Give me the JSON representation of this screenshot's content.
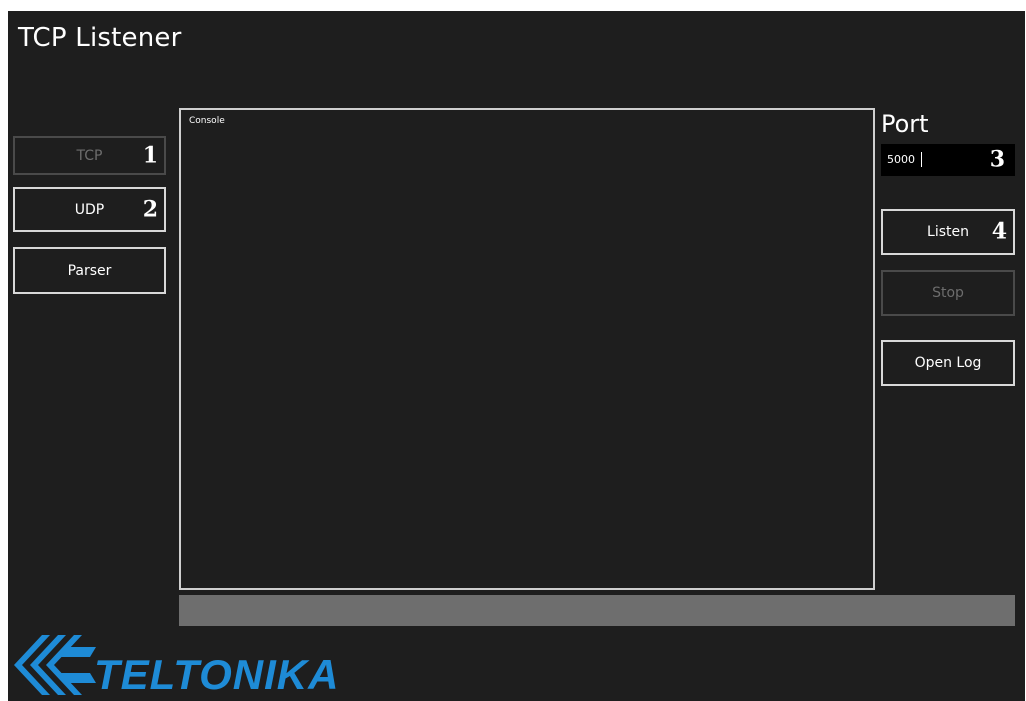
{
  "window": {
    "title": "TCP Listener"
  },
  "sidebar": {
    "buttons": [
      {
        "label": "TCP",
        "marker": "1",
        "enabled": false
      },
      {
        "label": "UDP",
        "marker": "2",
        "enabled": true
      },
      {
        "label": "Parser",
        "marker": "",
        "enabled": true
      }
    ]
  },
  "console": {
    "label": "Console",
    "content": ""
  },
  "port": {
    "label": "Port",
    "value": "5000",
    "marker": "3"
  },
  "actions": {
    "listen_label": "Listen",
    "listen_marker": "4",
    "stop_label": "Stop",
    "open_log_label": "Open Log"
  },
  "status_bar": {
    "text": ""
  },
  "logo": {
    "text": "TELTONIKA",
    "icon": "teltonika-chevron-logo-icon",
    "color": "#1e8bd6"
  },
  "colors": {
    "background": "#1e1e1e",
    "border": "#d8d8d8",
    "disabled": "#4a4a4a",
    "status_bar": "#6e6e6e",
    "port_field": "#000000"
  }
}
